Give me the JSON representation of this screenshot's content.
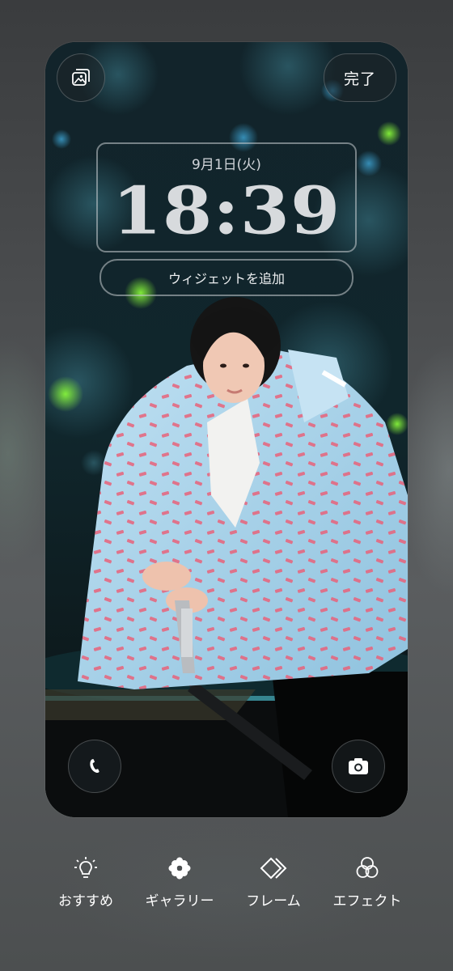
{
  "lockscreen": {
    "date": "9月1日(火)",
    "time": "18:39",
    "add_widget_label": "ウィジェットを追加"
  },
  "header": {
    "photo_icon": "photo-icon",
    "done_label": "完了"
  },
  "shortcuts": {
    "left_icon": "phone-icon",
    "right_icon": "camera-icon"
  },
  "bottom_tabs": [
    {
      "label": "おすすめ",
      "icon": "lightbulb-icon"
    },
    {
      "label": "ギャラリー",
      "icon": "flower-icon"
    },
    {
      "label": "フレーム",
      "icon": "frame-icon"
    },
    {
      "label": "エフェクト",
      "icon": "effects-icon"
    }
  ],
  "colors": {
    "background": "#4a4c4e",
    "clock_text": "#d7dadd",
    "jacket": "#a9d3ec",
    "pattern": "#e8627a"
  }
}
